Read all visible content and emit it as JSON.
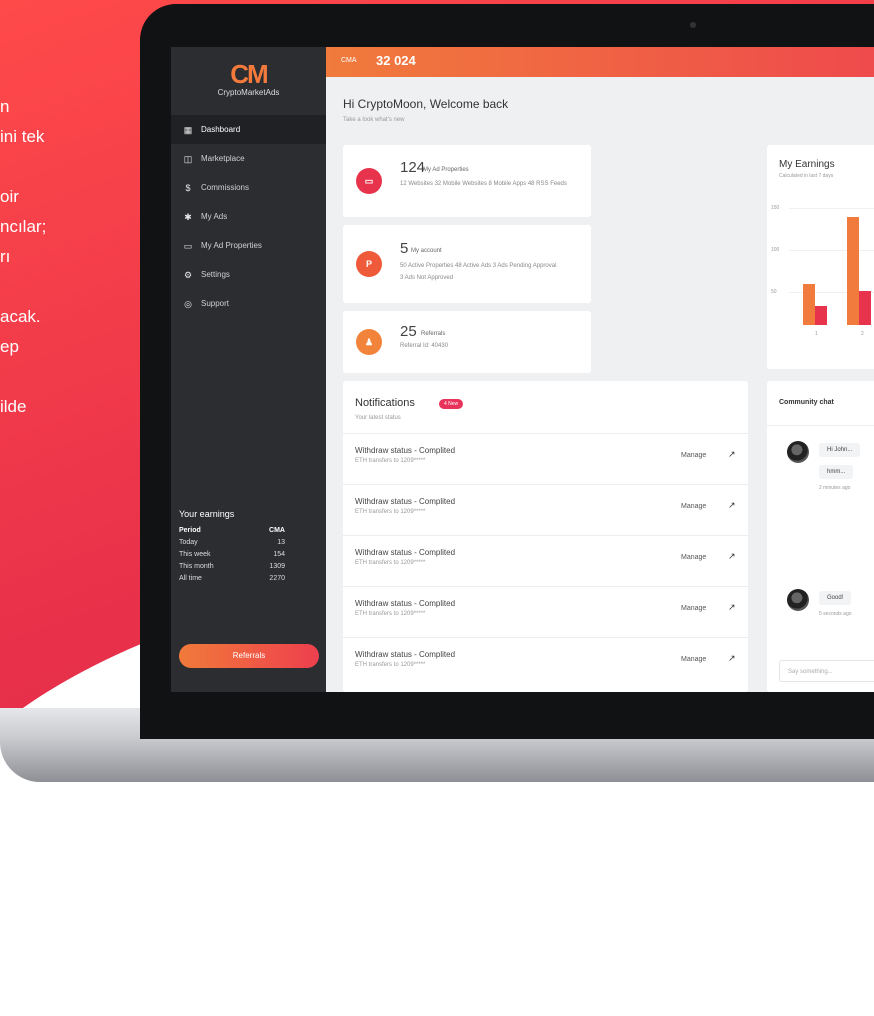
{
  "promo_text_lines": [
    "n",
    "ini tek",
    "",
    "oir",
    "ncılar;",
    "rı",
    "",
    "acak.",
    "ep",
    "",
    "ilde"
  ],
  "logo": {
    "mark": "CM",
    "name": "CryptoMarketAds"
  },
  "sidebar": {
    "items": [
      {
        "label": "Dashboard",
        "icon": "dashboard-icon",
        "glyph": "▦"
      },
      {
        "label": "Marketplace",
        "icon": "marketplace-icon",
        "glyph": "◫"
      },
      {
        "label": "Commissions",
        "icon": "dollar-icon",
        "glyph": "$"
      },
      {
        "label": "My Ads",
        "icon": "star-icon",
        "glyph": "✱"
      },
      {
        "label": "My Ad Properties",
        "icon": "monitor-icon",
        "glyph": "▭"
      },
      {
        "label": "Settings",
        "icon": "gear-icon",
        "glyph": "⚙"
      },
      {
        "label": "Support",
        "icon": "help-icon",
        "glyph": "◎"
      }
    ]
  },
  "earnings": {
    "title": "Your earnings",
    "head": {
      "period": "Period",
      "cma": "CMA"
    },
    "rows": [
      {
        "period": "Today",
        "cma": "13"
      },
      {
        "period": "This week",
        "cma": "154"
      },
      {
        "period": "This month",
        "cma": "1309"
      },
      {
        "period": "All time",
        "cma": "2270"
      }
    ],
    "button": "Referrals"
  },
  "topbar": {
    "label": "CMA",
    "value": "32 024"
  },
  "welcome": {
    "title": "Hi CryptoMoon, Welcome back",
    "subtitle": "Take a look what's new"
  },
  "stats": [
    {
      "number": "124",
      "label": "My Ad Properties",
      "sub": "12 Websites   32 Mobile Websites   8 Mobile Apps   48 RSS Feeds",
      "glyph": "▭",
      "color": "#e8334c"
    },
    {
      "number": "5",
      "label": "My account",
      "sub": "50 Active Properties   48 Active Ads   3 Ads Pending Approval",
      "sub2": "3 Ads Not Approved",
      "glyph": "P",
      "color": "#ef5a3a"
    },
    {
      "number": "25",
      "label": "Referrals",
      "sub": "Referral Id: 40430",
      "glyph": "♟",
      "color": "#f2833a"
    }
  ],
  "notifications": {
    "title": "Notifications",
    "badge": "4 New",
    "subtitle": "Your latest status",
    "rows": [
      {
        "title": "Withdraw status - Complited",
        "sub": "ETH transfers to 1209*****",
        "action": "Manage"
      },
      {
        "title": "Withdraw status - Complited",
        "sub": "ETH transfers to 1209*****",
        "action": "Manage"
      },
      {
        "title": "Withdraw status - Complited",
        "sub": "ETH transfers to 1209*****",
        "action": "Manage"
      },
      {
        "title": "Withdraw status - Complited",
        "sub": "ETH transfers to 1209*****",
        "action": "Manage"
      },
      {
        "title": "Withdraw status - Complited",
        "sub": "ETH transfers to 1209*****",
        "action": "Manage"
      }
    ]
  },
  "my_earnings": {
    "title": "My Earnings",
    "subtitle": "Calculated in last 7 days",
    "yticks": [
      "150",
      "100",
      "50"
    ],
    "xticks": [
      "1",
      "2"
    ],
    "colors": {
      "primary": "#f07b3c",
      "secondary": "#e8334c"
    },
    "bars": [
      0.34,
      0.16,
      0.9,
      0.28
    ]
  },
  "chat": {
    "title": "Community chat",
    "msg1": "Hi John...",
    "msg2": "hmm...",
    "time1": "2 minutes ago",
    "msg3": "Good!",
    "time2": "5 seconds ago",
    "placeholder": "Say something..."
  }
}
